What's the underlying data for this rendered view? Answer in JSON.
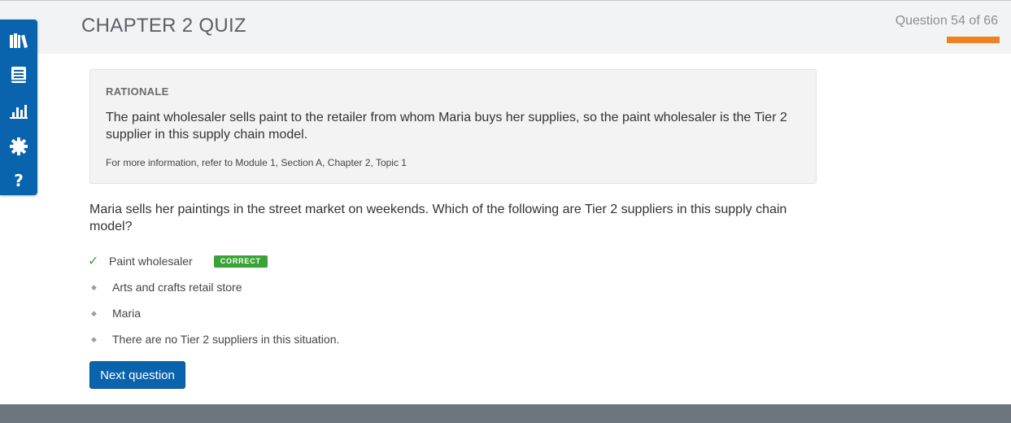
{
  "header": {
    "title": "CHAPTER 2 QUIZ",
    "progress_text": "Question 54 of 66",
    "progress_fraction": 0.818
  },
  "sidebar": {
    "items": [
      {
        "icon": "library-icon"
      },
      {
        "icon": "notebook-icon"
      },
      {
        "icon": "bar-chart-icon"
      },
      {
        "icon": "gear-icon"
      },
      {
        "icon": "help-icon",
        "glyph": "?"
      }
    ]
  },
  "rationale": {
    "heading": "RATIONALE",
    "body": "The paint wholesaler sells paint to the retailer from whom Maria buys her supplies, so the paint wholesaler is the Tier 2 supplier in this supply chain model.",
    "reference": "For more information, refer to Module 1, Section A, Chapter 2, Topic 1"
  },
  "question": {
    "text": "Maria sells her paintings in the street market on weekends. Which of the following are Tier 2 suppliers in this supply chain model?"
  },
  "answers": [
    {
      "label": "Paint wholesaler",
      "marker": "✓",
      "badge": "CORRECT"
    },
    {
      "label": "Arts and crafts retail store",
      "marker": "◆"
    },
    {
      "label": "Maria",
      "marker": "◆"
    },
    {
      "label": "There are no Tier 2 suppliers in this situation.",
      "marker": "◆"
    }
  ],
  "actions": {
    "next_label": "Next question"
  },
  "colors": {
    "brand_blue": "#0a63ad",
    "progress_orange": "#ef8220",
    "correct_green": "#3aa335"
  }
}
